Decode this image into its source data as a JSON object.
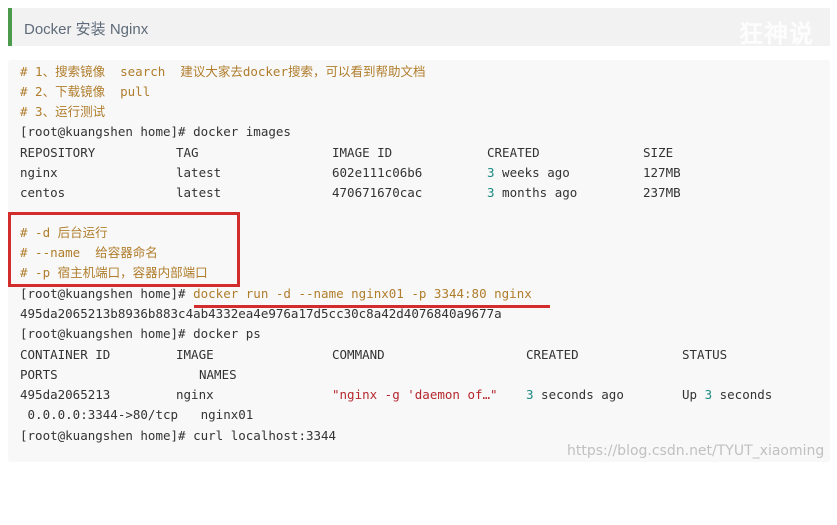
{
  "heading": {
    "title": "Docker 安装 Nginx",
    "logo_text": "狂神说"
  },
  "code": {
    "c1": "# 1、搜索镜像  search  建议大家去docker搜索，可以看到帮助文档",
    "c2": "# 2、下载镜像  pull",
    "c3": "# 3、运行测试",
    "p1": "[root@kuangshen home]# docker images",
    "img_head": [
      "REPOSITORY",
      "TAG",
      "IMAGE ID",
      "CREATED",
      "SIZE"
    ],
    "img_rows": [
      {
        "repo": "nginx",
        "tag": "latest",
        "id": "602e111c06b6",
        "n": "3",
        "unit": " weeks ago",
        "size": "127MB"
      },
      {
        "repo": "centos",
        "tag": "latest",
        "id": "470671670cac",
        "n": "3",
        "unit": " months ago",
        "size": "237MB"
      }
    ],
    "c4": "# -d 后台运行",
    "c5": "# --name  给容器命名",
    "c6": "# -p 宿主机端口，容器内部端口",
    "p2_prompt": "[root@kuangshen home]#",
    "p2_cmd": " docker run -d --name nginx01 -p 3344:80 nginx",
    "hash": "495da2065213b8936b883c4ab4332ea4e976a17d5cc30c8a42d4076840a9677a",
    "p3": "[root@kuangshen home]# docker ps",
    "ps_head": [
      "CONTAINER ID",
      "IMAGE",
      "COMMAND",
      "CREATED",
      "STATUS"
    ],
    "ps_head2": [
      "PORTS",
      "NAMES"
    ],
    "ps_row": {
      "id": "495da2065213",
      "image": "nginx",
      "command": "\"nginx -g 'daemon of…\"",
      "created_n": "3",
      "created_unit": " seconds ago",
      "status_pre": "Up ",
      "status_n": "3",
      "status_unit": " seconds"
    },
    "ps_row2": " 0.0.0.0:3344->80/tcp   nginx01",
    "p4": "[root@kuangshen home]# curl localhost:3344"
  },
  "watermark": "https://blog.csdn.net/TYUT_xiaoming",
  "colors": {
    "comment": "#b07d2b",
    "number": "#1c8a83",
    "string": "#b5282e",
    "highlight": "#d22c2c",
    "accent": "#4c9a4c"
  }
}
